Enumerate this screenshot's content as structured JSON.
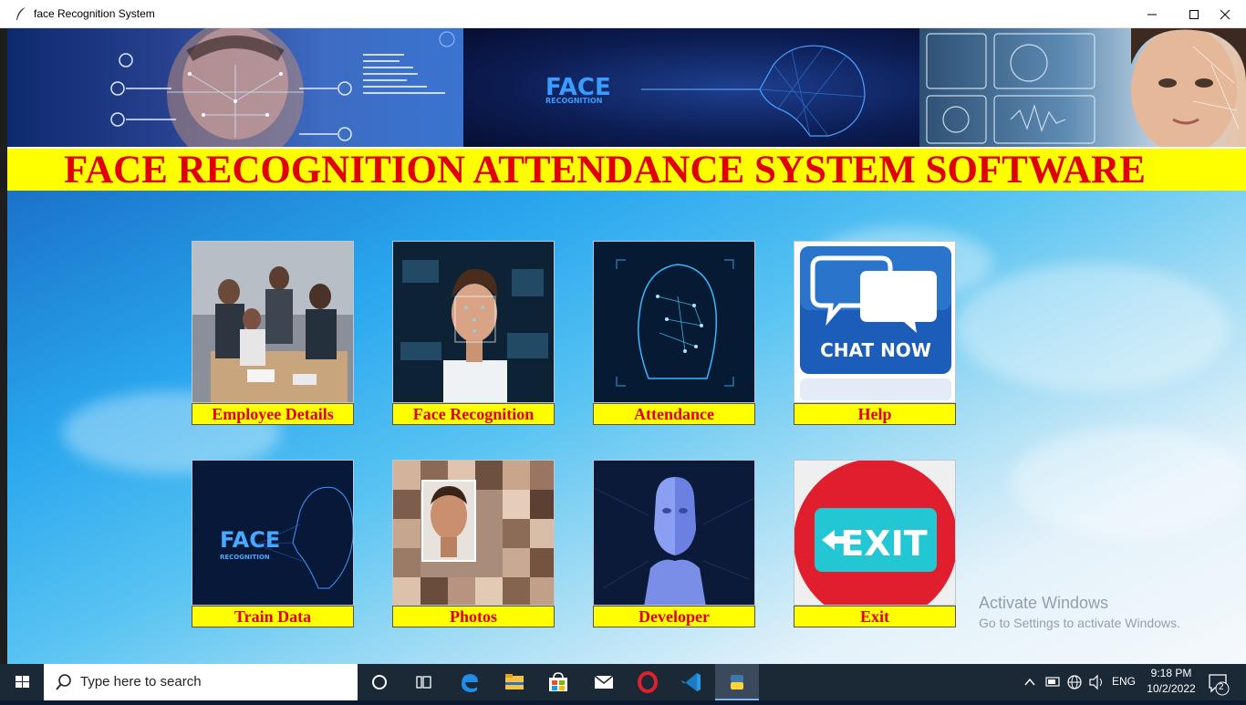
{
  "window": {
    "title": "face Recognition System"
  },
  "heading": "FACE RECOGNITION ATTENDANCE SYSTEM SOFTWARE",
  "banner": {
    "center_word_1": "FACE",
    "center_word_2": "RECOGNITION"
  },
  "tiles": [
    {
      "label": "Employee Details"
    },
    {
      "label": "Face Recognition"
    },
    {
      "label": "Attendance"
    },
    {
      "label": "Help",
      "image_text": "CHAT NOW"
    },
    {
      "label": "Train Data",
      "image_text_1": "FACE",
      "image_text_2": "RECOGNITION"
    },
    {
      "label": "Photos"
    },
    {
      "label": "Developer"
    },
    {
      "label": "Exit",
      "image_text": "EXIT"
    }
  ],
  "watermark": {
    "title": "Activate Windows",
    "subtitle": "Go to Settings to activate Windows."
  },
  "taskbar": {
    "search_placeholder": "Type here to search",
    "language": "ENG",
    "time": "9:18 PM",
    "date": "10/2/2022",
    "notification_count": "2"
  },
  "colors": {
    "heading_bg": "#ffff00",
    "heading_text": "#e00000",
    "label_bg": "#ffff00",
    "label_text": "#e00000"
  }
}
